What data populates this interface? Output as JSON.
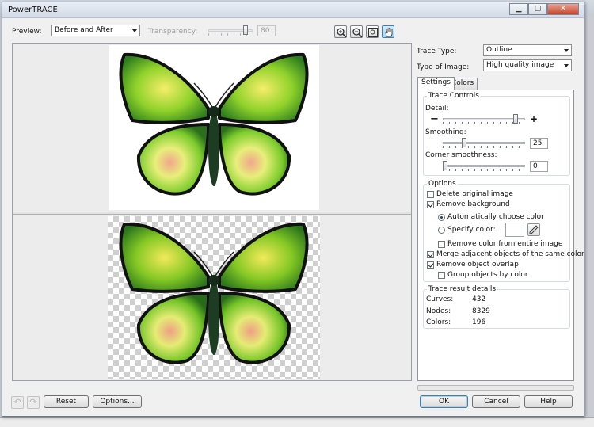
{
  "window": {
    "title": "PowerTRACE"
  },
  "toolbar": {
    "preview_label": "Preview:",
    "preview_value": "Before and After",
    "transparency_label": "Transparency:",
    "transparency_value": "80"
  },
  "trace": {
    "trace_type_label": "Trace Type:",
    "trace_type_value": "Outline",
    "image_type_label": "Type of Image:",
    "image_type_value": "High quality image"
  },
  "tabs": [
    {
      "label": "Settings"
    },
    {
      "label": "Colors"
    }
  ],
  "trace_controls": {
    "title": "Trace Controls",
    "detail_label": "Detail:",
    "detail_level": 0.93,
    "smoothing_label": "Smoothing:",
    "smoothing_value": "25",
    "corner_label": "Corner smoothness:",
    "corner_value": "0"
  },
  "options": {
    "title": "Options",
    "delete_original": {
      "label": "Delete original image",
      "checked": false
    },
    "remove_background": {
      "label": "Remove background",
      "checked": true
    },
    "auto_color": {
      "label": "Automatically choose color",
      "selected": true
    },
    "specify_color": {
      "label": "Specify color:",
      "selected": false
    },
    "remove_entire": {
      "label": "Remove color from entire image",
      "checked": false
    },
    "merge_adjacent": {
      "label": "Merge adjacent objects of the same color",
      "checked": true
    },
    "remove_overlap": {
      "label": "Remove object overlap",
      "checked": true
    },
    "group_by_color": {
      "label": "Group objects by color",
      "checked": false
    }
  },
  "results": {
    "title": "Trace result details",
    "curves_label": "Curves:",
    "curves_value": "432",
    "nodes_label": "Nodes:",
    "nodes_value": "8329",
    "colors_label": "Colors:",
    "colors_value": "196"
  },
  "footer": {
    "reset_label": "Reset",
    "options_label": "Options...",
    "ok_label": "OK",
    "cancel_label": "Cancel",
    "help_label": "Help"
  },
  "icons": {
    "zoom_in": "zoom-in-icon",
    "zoom_out": "zoom-out-icon",
    "zoom_fit": "zoom-fit-icon",
    "pan": "pan-hand-icon",
    "undo": "undo-icon",
    "redo": "redo-icon",
    "eyedropper": "eyedropper-icon"
  },
  "colors": {
    "accent": "#3c7fb1",
    "radio_dot": "#1c3c83"
  }
}
